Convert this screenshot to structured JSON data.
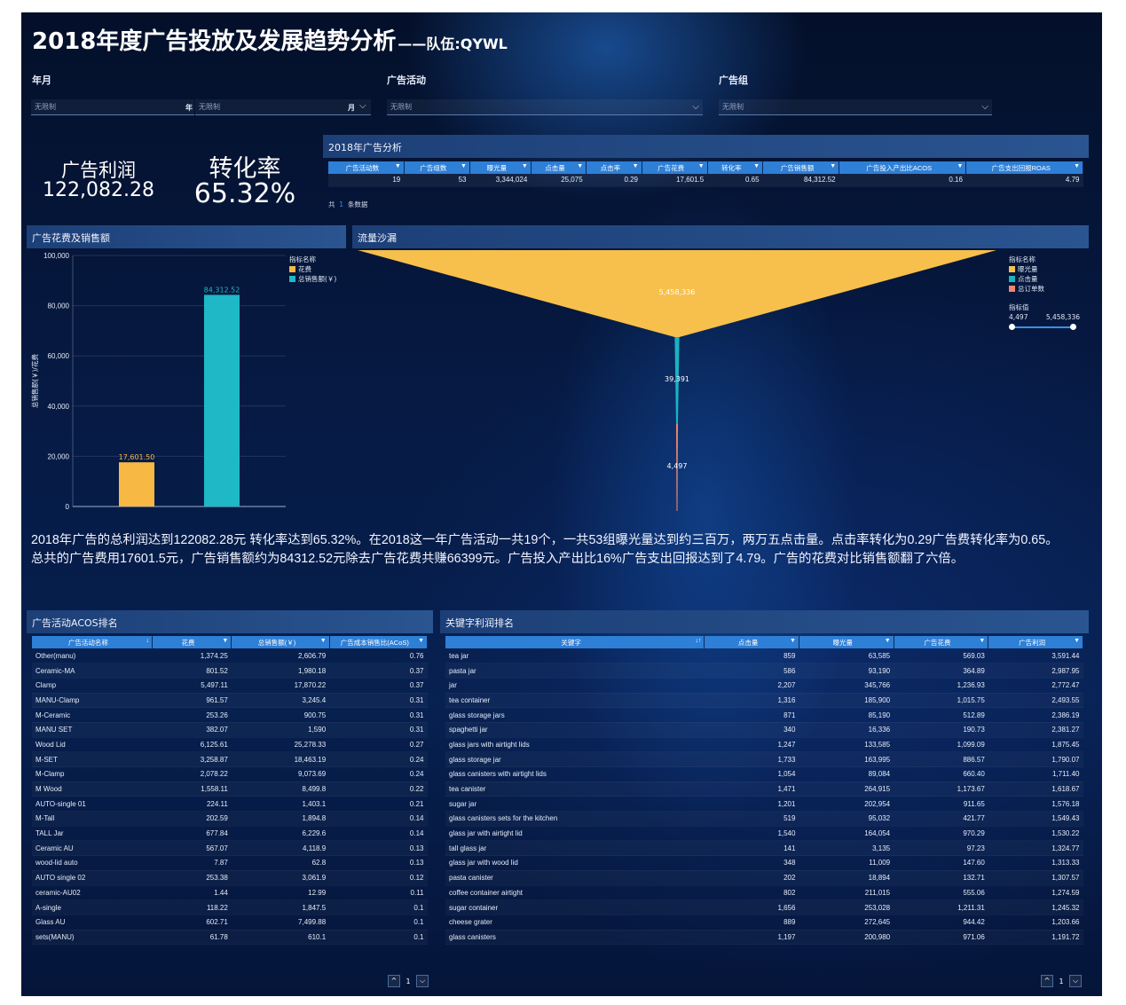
{
  "title": {
    "main": "2018年度广告投放及发展趋势分析",
    "sub": "——队伍:QYWL"
  },
  "filters": {
    "year_month_label": "年月",
    "year_placeholder": "无限制",
    "year_suffix": "年",
    "month_placeholder": "无限制",
    "month_suffix": "月",
    "campaign_label": "广告活动",
    "campaign_placeholder": "无限制",
    "adgroup_label": "广告组",
    "adgroup_placeholder": "无限制"
  },
  "kpi": {
    "profit_label": "广告利润",
    "profit_value": "122,082.28",
    "conv_label": "转化率",
    "conv_value": "65.32%"
  },
  "analysis": {
    "title": "2018年广告分析",
    "headers": [
      "广告活动数",
      "广告组数",
      "曝光量",
      "点击量",
      "点击率",
      "广告花费",
      "转化率",
      "广告销售额",
      "广告投入产出比ACOS",
      "广告支出回报ROAS"
    ],
    "row": [
      "19",
      "53",
      "3,344,024",
      "25,075",
      "0.29",
      "17,601.5",
      "0.65",
      "84,312.52",
      "0.16",
      "4.79"
    ],
    "footer_a": "共",
    "footer_b": "1",
    "footer_c": "条数据"
  },
  "spend_chart": {
    "title": "广告花费及销售额",
    "legend_title": "指标名称"
  },
  "funnel_chart": {
    "title": "流量沙漏",
    "legend_title": "指标名称",
    "range_title": "指标值",
    "range_min": "4,497",
    "range_max": "5,458,336"
  },
  "chart_data": [
    {
      "type": "bar",
      "title": "广告花费及销售额",
      "categories": [
        "花费",
        "总销售额(￥)"
      ],
      "values": [
        17601.5,
        84312.52
      ],
      "value_labels": [
        "17,601.50",
        "84,312.52"
      ],
      "colors": [
        "#f7b944",
        "#1fb8c6"
      ],
      "ylabel": "总销售额(￥)/花费",
      "ylim": [
        0,
        100000
      ],
      "yticks": [
        "0",
        "20,000",
        "40,000",
        "60,000",
        "80,000",
        "100,000"
      ],
      "grid": true,
      "legend": "top-right",
      "legend_entries": [
        "花费",
        "总销售额(￥)"
      ]
    },
    {
      "type": "funnel",
      "title": "流量沙漏",
      "stages": [
        "曝光量",
        "点击量",
        "总订单数"
      ],
      "values": [
        5458336,
        39391,
        4497
      ],
      "value_labels": [
        "5,458,336",
        "39,391",
        "4,497"
      ],
      "colors": [
        "#f7c04d",
        "#1ab3c4",
        "#f2866c"
      ],
      "legend": "top-right"
    }
  ],
  "summary": {
    "line1": "2018年广告的总利润达到122082.28元 转化率达到65.32%。在2018这一年广告活动一共19个，一共53组曝光量达到约三百万，两万五点击量。点击率转化为0.29广告费转化率为0.65。",
    "line2": "总共的广告费用17601.5元，广告销售额约为84312.52元除去广告花费共赚66399元。广告投入产出比16%广告支出回报达到了4.79。广告的花费对比销售额翻了六倍。"
  },
  "acos_table": {
    "title": "广告活动ACOS排名",
    "headers": [
      "广告活动名称",
      "花费",
      "总销售额(￥)",
      "广告成本销售比(ACoS)"
    ],
    "rows": [
      [
        "Other(manu)",
        "1,374.25",
        "2,606.79",
        "0.76"
      ],
      [
        "Ceramic-MA",
        "801.52",
        "1,980.18",
        "0.37"
      ],
      [
        "Clamp",
        "5,497.11",
        "17,870.22",
        "0.37"
      ],
      [
        "MANU-Clamp",
        "961.57",
        "3,245.4",
        "0.31"
      ],
      [
        "M-Ceramic",
        "253.26",
        "900.75",
        "0.31"
      ],
      [
        "MANU SET",
        "382.07",
        "1,590",
        "0.31"
      ],
      [
        "Wood Lid",
        "6,125.61",
        "25,278.33",
        "0.27"
      ],
      [
        "M-SET",
        "3,258.87",
        "18,463.19",
        "0.24"
      ],
      [
        "M-Clamp",
        "2,078.22",
        "9,073.69",
        "0.24"
      ],
      [
        "M Wood",
        "1,558.11",
        "8,499.8",
        "0.22"
      ],
      [
        "AUTO-single 01",
        "224.11",
        "1,403.1",
        "0.21"
      ],
      [
        "M-Tall",
        "202.59",
        "1,894.8",
        "0.14"
      ],
      [
        "TALL Jar",
        "677.84",
        "6,229.6",
        "0.14"
      ],
      [
        "Ceramic AU",
        "567.07",
        "4,118.9",
        "0.13"
      ],
      [
        "wood-lid auto",
        "7.87",
        "62.8",
        "0.13"
      ],
      [
        "AUTO single 02",
        "253.38",
        "3,061.9",
        "0.12"
      ],
      [
        "ceramic-AU02",
        "1.44",
        "12.99",
        "0.11"
      ],
      [
        "A-single",
        "118.22",
        "1,847.5",
        "0.1"
      ],
      [
        "Glass AU",
        "602.71",
        "7,499.88",
        "0.1"
      ],
      [
        "sets(MANU)",
        "61.78",
        "610.1",
        "0.1"
      ]
    ],
    "page": "1"
  },
  "keyword_table": {
    "title": "关键字利润排名",
    "headers": [
      "关键字",
      "点击量",
      "曝光量",
      "广告花费",
      "广告利润"
    ],
    "rows": [
      [
        "tea jar",
        "859",
        "63,585",
        "569.03",
        "3,591.44"
      ],
      [
        "pasta jar",
        "586",
        "93,190",
        "364.89",
        "2,987.95"
      ],
      [
        "jar",
        "2,207",
        "345,766",
        "1,236.93",
        "2,772.47"
      ],
      [
        "tea container",
        "1,316",
        "185,900",
        "1,015.75",
        "2,493.55"
      ],
      [
        "glass storage jars",
        "871",
        "85,190",
        "512.89",
        "2,386.19"
      ],
      [
        "spaghetti jar",
        "340",
        "16,336",
        "190.73",
        "2,381.27"
      ],
      [
        "glass jars with airtight lids",
        "1,247",
        "133,585",
        "1,099.09",
        "1,875.45"
      ],
      [
        "glass storage jar",
        "1,733",
        "163,995",
        "886.57",
        "1,790.07"
      ],
      [
        "glass canisters with airtight lids",
        "1,054",
        "89,084",
        "660.40",
        "1,711.40"
      ],
      [
        "tea canister",
        "1,471",
        "264,915",
        "1,173.67",
        "1,618.67"
      ],
      [
        "sugar jar",
        "1,201",
        "202,954",
        "911.65",
        "1,576.18"
      ],
      [
        "glass canisters sets for the kitchen",
        "519",
        "95,032",
        "421.77",
        "1,549.43"
      ],
      [
        "glass jar with airtight lid",
        "1,540",
        "164,054",
        "970.29",
        "1,530.22"
      ],
      [
        "tall glass jar",
        "141",
        "3,135",
        "97.23",
        "1,324.77"
      ],
      [
        "glass jar with wood lid",
        "348",
        "11,009",
        "147.60",
        "1,313.33"
      ],
      [
        "pasta canister",
        "202",
        "18,894",
        "132.71",
        "1,307.57"
      ],
      [
        "coffee container airtight",
        "802",
        "211,015",
        "555.06",
        "1,274.59"
      ],
      [
        "sugar container",
        "1,656",
        "253,028",
        "1,211.31",
        "1,245.32"
      ],
      [
        "cheese grater",
        "889",
        "272,645",
        "944.42",
        "1,203.66"
      ],
      [
        "glass canisters",
        "1,197",
        "200,980",
        "971.06",
        "1,191.72"
      ]
    ],
    "page": "1"
  }
}
